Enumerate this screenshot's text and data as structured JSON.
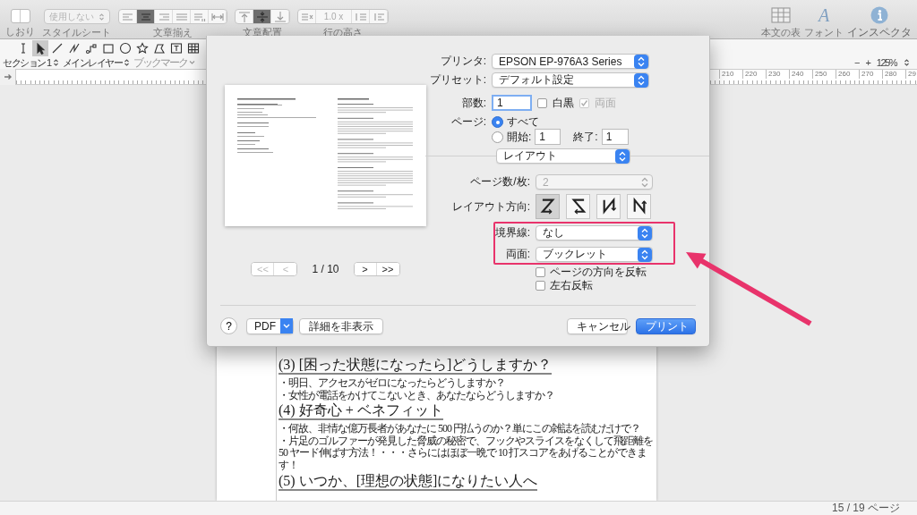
{
  "toolbar": {
    "bookmarks_label": "しおり",
    "stylesheet": {
      "value": "使用しない",
      "label": "スタイルシート",
      "disabled": true
    },
    "text_align": {
      "label": "文章揃え",
      "buttons": [
        {
          "kind": "left",
          "selected": false
        },
        {
          "kind": "center",
          "selected": true
        },
        {
          "kind": "right",
          "selected": false
        },
        {
          "kind": "justify",
          "selected": false
        },
        {
          "kind": "spacing",
          "selected": false
        },
        {
          "kind": "width",
          "selected": false
        }
      ]
    },
    "text_position": {
      "label": "文章配置",
      "buttons": [
        {
          "kind": "top",
          "selected": false
        },
        {
          "kind": "middle",
          "selected": true
        },
        {
          "kind": "bottom",
          "selected": false
        }
      ]
    },
    "line_height": {
      "label": "行の高さ",
      "value": "1.0 x"
    },
    "right_tools": [
      {
        "kind": "table",
        "label": "本文の表"
      },
      {
        "kind": "font",
        "glyph": "A",
        "label": "フォント"
      },
      {
        "kind": "inspector",
        "label": "インスペクタ"
      }
    ]
  },
  "tool_palette": [
    {
      "kind": "text-cursor",
      "selected": false
    },
    {
      "kind": "pointer",
      "selected": true
    },
    {
      "kind": "line",
      "selected": false
    },
    {
      "kind": "polyline",
      "selected": false
    },
    {
      "kind": "connector",
      "selected": false
    },
    {
      "kind": "rectangle",
      "selected": false
    },
    {
      "kind": "ellipse",
      "selected": false
    },
    {
      "kind": "star",
      "selected": false
    },
    {
      "kind": "polygon",
      "selected": false
    },
    {
      "kind": "text-box",
      "selected": false
    },
    {
      "kind": "table",
      "selected": false
    }
  ],
  "nav_bar": {
    "section": "セクション 1",
    "layer": "メインレイヤー",
    "bookmark": {
      "label": "ブックマーク",
      "disabled": true
    }
  },
  "zoom": {
    "zoom_out": "−",
    "zoom_in": "+",
    "value": "125%"
  },
  "ruler": {
    "labels": [
      "210",
      "220",
      "230",
      "240",
      "250",
      "260",
      "270",
      "280",
      "29"
    ]
  },
  "document": {
    "blocks": [
      {
        "kind": "heading",
        "text": "(3) [困った状態になったら]どうしますか？"
      },
      {
        "kind": "bullet",
        "text": "・明日、アクセスがゼロになったらどうしますか？"
      },
      {
        "kind": "bullet",
        "text": "・女性が電話をかけてこないとき、あなたならどうしますか？"
      },
      {
        "kind": "heading",
        "text": "(4) 好奇心 + ベネフィット"
      },
      {
        "kind": "bullet",
        "text": "・何故、非情な億万長者があなたに 500 円払うのか？単にこの雑誌を読むだけで？"
      },
      {
        "kind": "bullet",
        "text": "・片足のゴルファーが発見した脅威の秘密で、フックやスライスをなくして飛距離を 50 ヤード伸ばす方法！・・・さらにはほぼ一晩で 10 打スコアをあげることができます！"
      },
      {
        "kind": "heading",
        "text": "(5) いつか、[理想の状態]になりたい人へ"
      }
    ]
  },
  "status_bar": {
    "page": "15 / 19 ページ"
  },
  "print_dialog": {
    "preview": {
      "page": "1 / 10",
      "nav_buttons": [
        {
          "label": "<<",
          "disabled": true
        },
        {
          "label": "<",
          "disabled": true
        },
        {
          "label": ">",
          "disabled": false
        },
        {
          "label": ">>",
          "disabled": false
        }
      ]
    },
    "printer": {
      "label": "プリンタ:",
      "value": "EPSON EP-976A3 Series"
    },
    "preset": {
      "label": "プリセット:",
      "value": "デフォルト設定"
    },
    "copies": {
      "label": "部数:",
      "value": "1"
    },
    "black_white": {
      "label": "白黒",
      "checked": false,
      "disabled": false
    },
    "two_sided": {
      "label": "両面",
      "checked": true,
      "disabled": true
    },
    "pages": {
      "label": "ページ:",
      "options": [
        {
          "label": "すべて",
          "selected": true
        },
        {
          "label": "開始:",
          "selected": false
        }
      ],
      "from": "1",
      "to_label": "終了:",
      "to": "1"
    },
    "section_menu": "レイアウト",
    "pages_per_sheet": {
      "label": "ページ数/枚:",
      "value": "2",
      "disabled": true
    },
    "layout_direction": {
      "label": "レイアウト方向:",
      "options": [
        {
          "kind": "z",
          "selected": true
        },
        {
          "kind": "z-mirrored",
          "selected": false
        },
        {
          "kind": "n-mirrored",
          "selected": false
        },
        {
          "kind": "n",
          "selected": false
        }
      ]
    },
    "border": {
      "label": "境界線:",
      "value": "なし"
    },
    "duplex": {
      "label": "両面:",
      "value": "ブックレット"
    },
    "checkboxes": [
      {
        "label": "ページの方向を反転",
        "checked": false
      },
      {
        "label": "左右反転",
        "checked": false
      }
    ],
    "help": "?",
    "pdf": "PDF",
    "details": "詳細を非表示",
    "cancel": "キャンセル",
    "print": "プリント"
  }
}
